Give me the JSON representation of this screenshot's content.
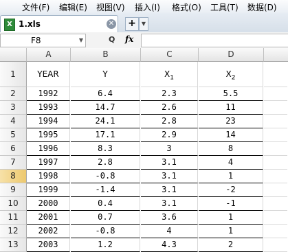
{
  "menu": [
    "文件(F)",
    "编辑(E)",
    "视图(V)",
    "插入(I)",
    "格式(O)",
    "工具(T)",
    "数据(D)"
  ],
  "file_tab": {
    "icon_text": "X",
    "name": "1.xls"
  },
  "new_tab_label": "+",
  "formula_bar": {
    "cell_ref": "F8",
    "zoom_icon_text": "Q",
    "fx_label": "fx",
    "formula": ""
  },
  "columns": [
    "A",
    "B",
    "C",
    "D"
  ],
  "rows": [
    {
      "n": "1",
      "a": "YEAR",
      "b": "Y",
      "c": "X",
      "c_sub": "1",
      "d": "X",
      "d_sub": "2"
    },
    {
      "n": "2",
      "a": "1992",
      "b": "6.4",
      "c": "2.3",
      "d": "5.5"
    },
    {
      "n": "3",
      "a": "1993",
      "b": "14.7",
      "c": "2.6",
      "d": "11"
    },
    {
      "n": "4",
      "a": "1994",
      "b": "24.1",
      "c": "2.8",
      "d": "23"
    },
    {
      "n": "5",
      "a": "1995",
      "b": "17.1",
      "c": "2.9",
      "d": "14"
    },
    {
      "n": "6",
      "a": "1996",
      "b": "8.3",
      "c": "3",
      "d": "8"
    },
    {
      "n": "7",
      "a": "1997",
      "b": "2.8",
      "c": "3.1",
      "d": "4"
    },
    {
      "n": "8",
      "a": "1998",
      "b": "-0.8",
      "c": "3.1",
      "d": "1"
    },
    {
      "n": "9",
      "a": "1999",
      "b": "-1.4",
      "c": "3.1",
      "d": "-2"
    },
    {
      "n": "10",
      "a": "2000",
      "b": "0.4",
      "c": "3.1",
      "d": "-1"
    },
    {
      "n": "11",
      "a": "2001",
      "b": "0.7",
      "c": "3.6",
      "d": "1"
    },
    {
      "n": "12",
      "a": "2002",
      "b": "-0.8",
      "c": "4",
      "d": "1"
    },
    {
      "n": "13",
      "a": "2003",
      "b": "1.2",
      "c": "4.3",
      "d": "2"
    }
  ]
}
